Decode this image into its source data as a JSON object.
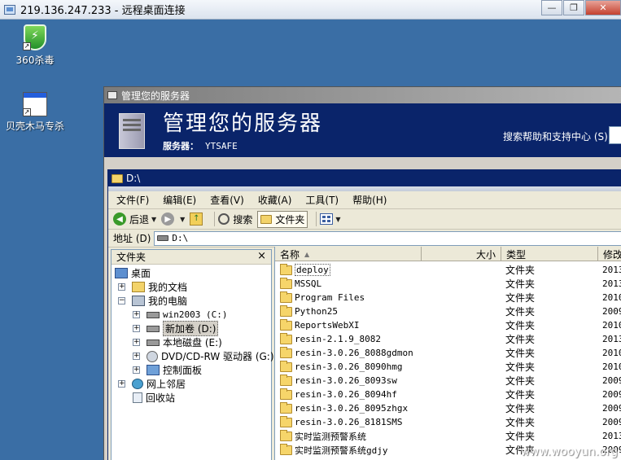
{
  "remote_desktop": {
    "title": "219.136.247.233 - 远程桌面连接",
    "minimize": "—",
    "restore": "❐",
    "close": "✕"
  },
  "desktop": {
    "icons": [
      {
        "label": "360杀毒",
        "icon": "shield-icon"
      },
      {
        "label": "贝壳木马专杀",
        "icon": "app-window-icon"
      }
    ]
  },
  "server_manager": {
    "window_title": "管理您的服务器",
    "heading": "管理您的服务器",
    "server_label": "服务器：",
    "server_name": "YTSAFE",
    "search_label": "搜索帮助和支持中心 (S)"
  },
  "explorer": {
    "title": "D:\\",
    "menu": [
      "文件(F)",
      "编辑(E)",
      "查看(V)",
      "收藏(A)",
      "工具(T)",
      "帮助(H)"
    ],
    "toolbar": {
      "back": "后退",
      "search": "搜索",
      "folders": "文件夹"
    },
    "address_label": "地址 (D)",
    "address_value": "D:\\",
    "folder_pane": {
      "title": "文件夹",
      "close": "×",
      "tree": [
        {
          "label": "桌面",
          "icon": "desktop-icon",
          "expander": ""
        },
        {
          "label": "我的文档",
          "icon": "documents-icon",
          "expander": "+"
        },
        {
          "label": "我的电脑",
          "icon": "computer-icon",
          "expander": "−"
        },
        {
          "label": "win2003 (C:)",
          "icon": "drive-icon",
          "expander": "+"
        },
        {
          "label": "新加卷 (D:)",
          "icon": "drive-icon",
          "expander": "+"
        },
        {
          "label": "本地磁盘 (E:)",
          "icon": "drive-icon",
          "expander": "+"
        },
        {
          "label": "DVD/CD-RW 驱动器 (G:)",
          "icon": "cd-drive-icon",
          "expander": "+"
        },
        {
          "label": "控制面板",
          "icon": "control-panel-icon",
          "expander": "+"
        },
        {
          "label": "网上邻居",
          "icon": "network-icon",
          "expander": "+"
        },
        {
          "label": "回收站",
          "icon": "recycle-bin-icon",
          "expander": ""
        }
      ]
    },
    "columns": {
      "name": "名称",
      "size": "大小",
      "type": "类型",
      "modified": "修改"
    },
    "files": [
      {
        "name": "deploy",
        "type": "文件夹",
        "modified": "2013"
      },
      {
        "name": "MSSQL",
        "type": "文件夹",
        "modified": "2013"
      },
      {
        "name": "Program Files",
        "type": "文件夹",
        "modified": "2010"
      },
      {
        "name": "Python25",
        "type": "文件夹",
        "modified": "2009"
      },
      {
        "name": "ReportsWebXI",
        "type": "文件夹",
        "modified": "2010"
      },
      {
        "name": "resin-2.1.9_8082",
        "type": "文件夹",
        "modified": "2013"
      },
      {
        "name": "resin-3.0.26_8088gdmon",
        "type": "文件夹",
        "modified": "2010"
      },
      {
        "name": "resin-3.0.26_8090hmg",
        "type": "文件夹",
        "modified": "2010"
      },
      {
        "name": "resin-3.0.26_8093sw",
        "type": "文件夹",
        "modified": "2009"
      },
      {
        "name": "resin-3.0.26_8094hf",
        "type": "文件夹",
        "modified": "2009"
      },
      {
        "name": "resin-3.0.26_8095zhgx",
        "type": "文件夹",
        "modified": "2009"
      },
      {
        "name": "resin-3.0.26_8181SMS",
        "type": "文件夹",
        "modified": "2009"
      },
      {
        "name": "实时监测预警系统",
        "type": "文件夹",
        "modified": "2013"
      },
      {
        "name": "实时监测预警系统gdjy",
        "type": "文件夹",
        "modified": "2009"
      }
    ]
  },
  "watermark": "www.wooyun.org"
}
